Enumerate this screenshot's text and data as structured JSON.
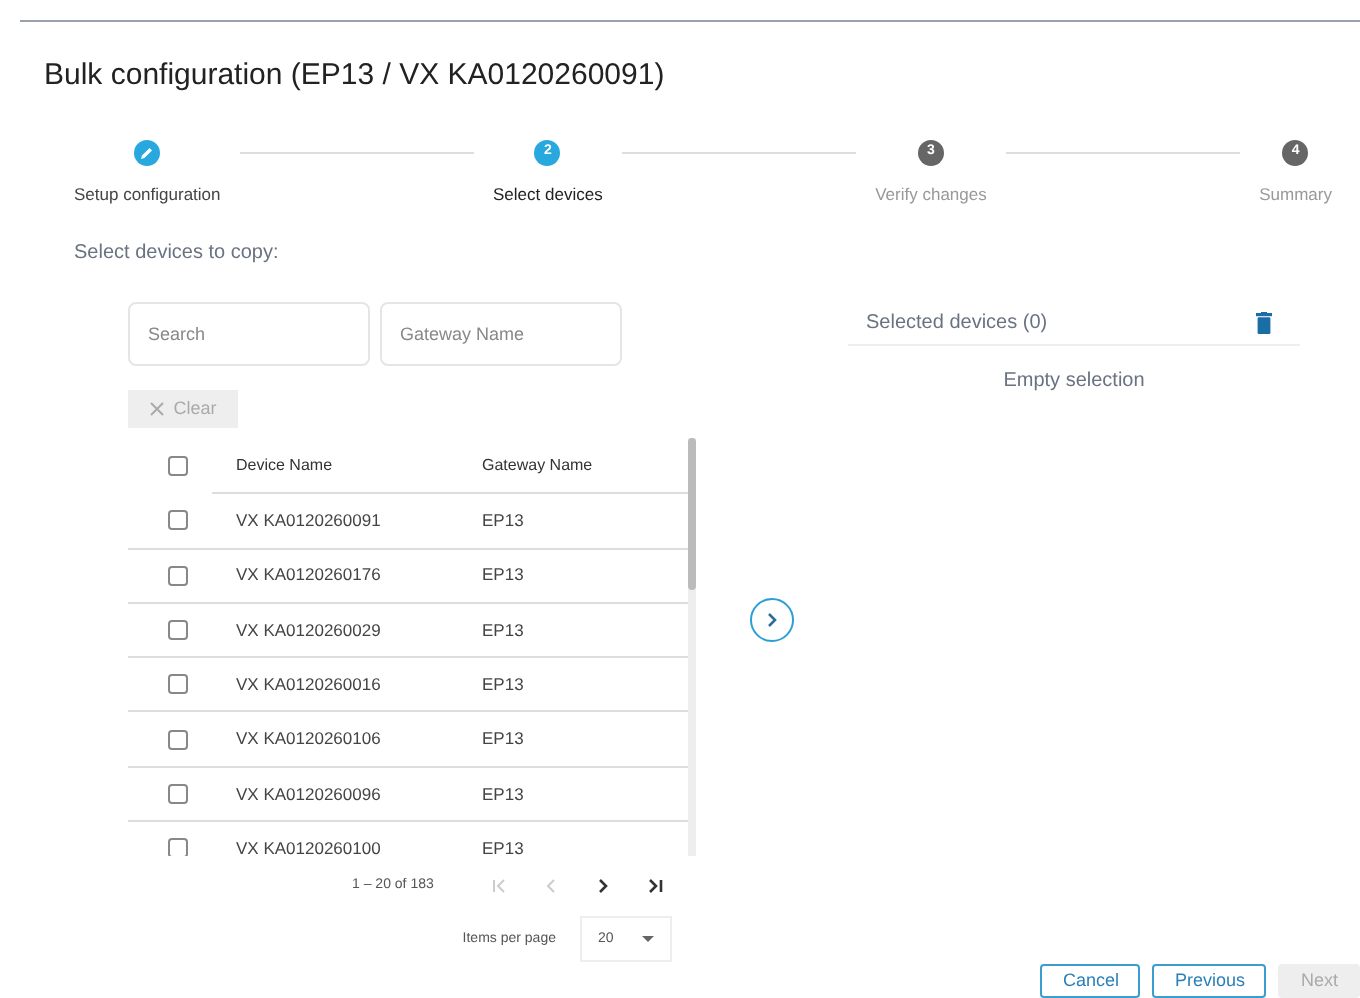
{
  "title": "Bulk configuration (EP13 / VX KA0120260091)",
  "steps": [
    {
      "label": "Setup configuration",
      "completed": true,
      "selected": false
    },
    {
      "label": "Select devices",
      "completed": false,
      "selected": true,
      "number": "2"
    },
    {
      "label": "Verify changes",
      "completed": false,
      "selected": false,
      "number": "3"
    },
    {
      "label": "Summary",
      "completed": false,
      "selected": false,
      "number": "4"
    }
  ],
  "instruction": "Select devices to copy:",
  "filters": [
    {
      "placeholder": "Search"
    },
    {
      "placeholder": "Gateway Name"
    }
  ],
  "clear_button": {
    "label": "Clear",
    "disabled": true
  },
  "table": {
    "columns": [
      "Device Name",
      "Gateway Name"
    ],
    "header_checked": false,
    "rows": [
      {
        "device": "VX KA0120260091",
        "gateway": "EP13",
        "checked": false
      },
      {
        "device": "VX KA0120260176",
        "gateway": "EP13",
        "checked": false
      },
      {
        "device": "VX KA0120260029",
        "gateway": "EP13",
        "checked": false
      },
      {
        "device": "VX KA0120260016",
        "gateway": "EP13",
        "checked": false
      },
      {
        "device": "VX KA0120260106",
        "gateway": "EP13",
        "checked": false
      },
      {
        "device": "VX KA0120260096",
        "gateway": "EP13",
        "checked": false
      },
      {
        "device": "VX KA0120260100",
        "gateway": "EP13",
        "checked": false
      }
    ]
  },
  "pagination": {
    "range": "1 – 20 of 183",
    "items_per_page_label": "Items per page",
    "page_size": "20"
  },
  "selected_panel": {
    "title": "Selected devices (0)",
    "empty_text": "Empty selection"
  },
  "buttons": [
    {
      "label": "Cancel",
      "disabled": false
    },
    {
      "label": "Previous",
      "disabled": false
    },
    {
      "label": "Next",
      "disabled": true
    }
  ]
}
